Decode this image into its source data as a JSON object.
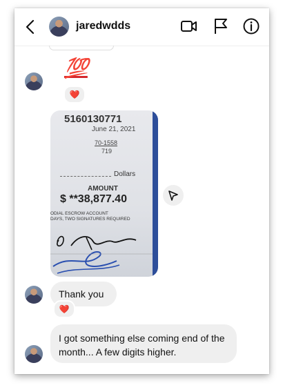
{
  "header": {
    "username": "jaredwdds",
    "icons": [
      "back-arrow-icon",
      "video-call-icon",
      "flag-icon",
      "info-icon"
    ]
  },
  "messages": {
    "emoji": "💯",
    "emoji_reaction": "❤️",
    "check_photo": {
      "check_number": "5160130771",
      "date": "June 21, 2021",
      "routing": "70-1558",
      "routing_sub": "719",
      "dollars_label": "Dollars",
      "amount_label": "AMOUNT",
      "amount": "$ **38,877.40",
      "note_line1": "ODIAL ESCROW ACCOUNT",
      "note_line2": "DAYS, TWO SIGNATURES REQUIRED"
    },
    "text1": "Thank you",
    "text1_reaction": "❤️",
    "text2": "I got something else coming end of the month... A few digits higher."
  },
  "colors": {
    "bubble_bg": "#efefef",
    "heart": "#e0245e",
    "check_edge": "#2d4e9a"
  }
}
